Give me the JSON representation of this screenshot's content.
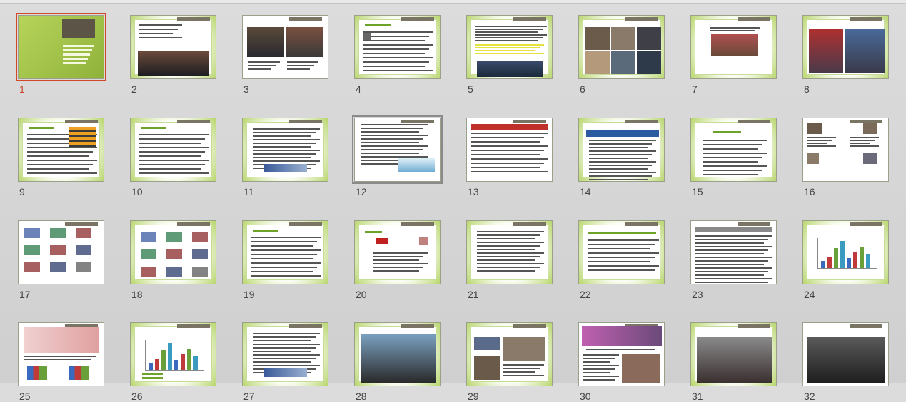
{
  "slides": [
    {
      "num": "1",
      "style": "title",
      "selected": true
    },
    {
      "num": "2",
      "style": "green-photo"
    },
    {
      "num": "3",
      "style": "white-photo"
    },
    {
      "num": "4",
      "style": "green-text"
    },
    {
      "num": "5",
      "style": "green-yellowtext"
    },
    {
      "num": "6",
      "style": "green-photogrid"
    },
    {
      "num": "7",
      "style": "green-photo-small"
    },
    {
      "num": "8",
      "style": "green-photo-wide"
    },
    {
      "num": "9",
      "style": "green-text-chart"
    },
    {
      "num": "10",
      "style": "green-text"
    },
    {
      "num": "11",
      "style": "green-doc"
    },
    {
      "num": "12",
      "style": "white-doc",
      "hover": true
    },
    {
      "num": "13",
      "style": "white-table-red"
    },
    {
      "num": "14",
      "style": "green-web"
    },
    {
      "num": "15",
      "style": "green-bullets"
    },
    {
      "num": "16",
      "style": "white-people"
    },
    {
      "num": "17",
      "style": "white-logos"
    },
    {
      "num": "18",
      "style": "green-logos"
    },
    {
      "num": "19",
      "style": "green-list"
    },
    {
      "num": "20",
      "style": "green-certificate"
    },
    {
      "num": "21",
      "style": "green-letter"
    },
    {
      "num": "22",
      "style": "green-bigtext"
    },
    {
      "num": "23",
      "style": "white-dense-table"
    },
    {
      "num": "24",
      "style": "green-barchart"
    },
    {
      "num": "25",
      "style": "white-map"
    },
    {
      "num": "26",
      "style": "green-barchart2"
    },
    {
      "num": "27",
      "style": "green-doc"
    },
    {
      "num": "28",
      "style": "green-photo-crowd"
    },
    {
      "num": "29",
      "style": "green-collage"
    },
    {
      "num": "30",
      "style": "white-magazine"
    },
    {
      "num": "31",
      "style": "green-photo-group"
    },
    {
      "num": "32",
      "style": "white-photo-meeting"
    }
  ],
  "colors": {
    "accent_selected": "#c8452a",
    "slide_green": "#9cc24a",
    "tab_dark": "#7a7464"
  }
}
